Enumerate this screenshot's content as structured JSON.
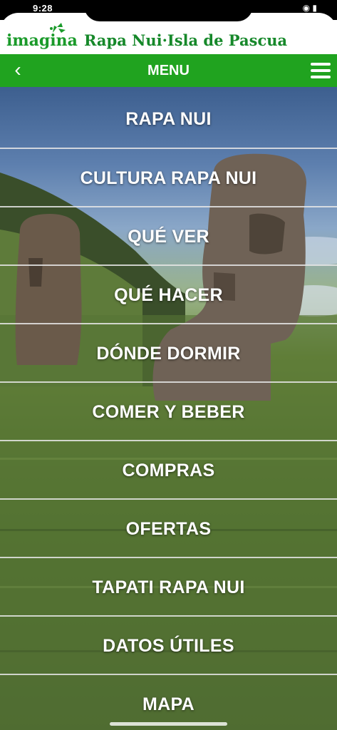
{
  "status_bar": {
    "time": "9:28"
  },
  "brand": {
    "imagina": "imagina",
    "place": "Rapa Nui·Isla de Pascua"
  },
  "nav": {
    "back_icon": "chevron-left-icon",
    "title": "MENU",
    "menu_icon": "hamburger-icon"
  },
  "menu": {
    "items": [
      {
        "label": "RAPA NUI"
      },
      {
        "label": "CULTURA RAPA NUI"
      },
      {
        "label": "QUÉ VER"
      },
      {
        "label": "QUÉ HACER"
      },
      {
        "label": "DÓNDE DORMIR"
      },
      {
        "label": "COMER Y BEBER"
      },
      {
        "label": "COMPRAS"
      },
      {
        "label": "OFERTAS"
      },
      {
        "label": "TAPATI RAPA NUI"
      },
      {
        "label": "DATOS ÚTILES"
      },
      {
        "label": "MAPA"
      }
    ]
  },
  "colors": {
    "brand_green": "#20a31f",
    "logo_green": "#1a9a2a"
  }
}
